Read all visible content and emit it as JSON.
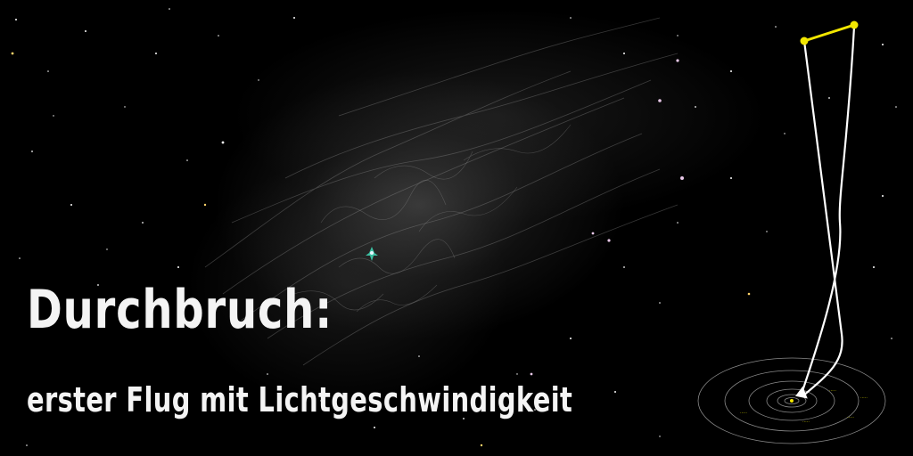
{
  "banner": {
    "headline": "Durchbruch:",
    "subline": "erster Flug mit Lichtgeschwindigkeit"
  },
  "colors": {
    "background": "#000000",
    "text": "#f4f4f4",
    "flight_path": "#ffffff",
    "marker": "#f2e600",
    "orbit": "#8a8a8a"
  },
  "icons": [
    "spaceship-icon",
    "yellow-marker-icon",
    "flight-path-arrow-icon"
  ]
}
